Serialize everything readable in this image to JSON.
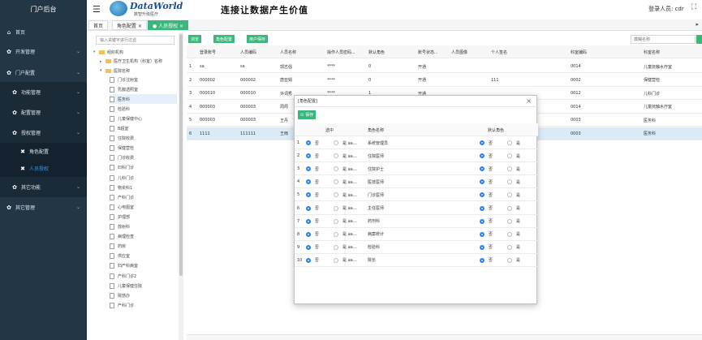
{
  "sidebar": {
    "title": "门户后台",
    "items": [
      {
        "label": "首页",
        "icon": "home-icon"
      },
      {
        "label": "开发管理",
        "icon": "gear-icon"
      },
      {
        "label": "门户配置",
        "icon": "gear-icon"
      },
      {
        "label": "功能管理",
        "icon": "gear-icon"
      },
      {
        "label": "配置管理",
        "icon": "gear-icon"
      },
      {
        "label": "授权管理",
        "icon": "gear-icon"
      },
      {
        "label": "角色配置",
        "icon": "tools-icon"
      },
      {
        "label": "人员授权",
        "icon": "tools-icon"
      },
      {
        "label": "其它功能",
        "icon": "gear-icon"
      },
      {
        "label": "其它管理",
        "icon": "gear-icon"
      }
    ]
  },
  "header": {
    "logo_text": "DataWorld",
    "logo_sub": "数智升级医疗",
    "slogan": "连接让数据产生价值",
    "user_label": "登录人员: cdr"
  },
  "tabs": [
    {
      "label": "首页"
    },
    {
      "label": "角色配置 ×"
    },
    {
      "label": "● 人员授权 ×"
    }
  ],
  "tree": {
    "search_placeholder": "输入关键字进行过滤",
    "nodes": [
      "组织机构",
      "医疗卫生机构（科室）名称",
      "医院名称",
      "门诊注射室",
      "乳腺透照室",
      "医务科",
      "检验科",
      "儿童保健中心",
      "B超室",
      "住院收费",
      "保健营检",
      "门诊收费",
      "妇科门诊",
      "儿科门诊",
      "物资科1",
      "产科门诊",
      "心电图室",
      "护理部",
      "放射科",
      "病理检查",
      "药房",
      "供应室",
      "妇产科病室",
      "产科门诊2",
      "儿童保健住院",
      "院感办",
      "产科门诊"
    ]
  },
  "toolbar": {
    "buttons": [
      "浏览",
      "角色配置",
      "用户保存"
    ],
    "search_placeholder": "模糊名称"
  },
  "grid": {
    "headers": [
      "登录账号",
      "人员编码",
      "人员名称",
      "操作人员密码...",
      "默认角色",
      "账号状态...",
      "人员图像",
      "个人签名",
      "科室编码",
      "科室名称"
    ],
    "rows": [
      [
        "sa",
        "sa",
        "郭志强",
        "****",
        "0",
        "开通",
        "",
        "",
        "0014",
        "儿童抚触水疗室"
      ],
      [
        "000002",
        "000002",
        "唐亚娟",
        "****",
        "0",
        "开通",
        "",
        "111",
        "0002",
        "保健营检"
      ],
      [
        "000010",
        "000010",
        "许词秀",
        "****",
        "1",
        "开通",
        "",
        "",
        "0012",
        "儿科门诊"
      ],
      [
        "000003",
        "000003",
        "周周",
        "",
        "",
        "",
        "",
        "",
        "0014",
        "儿童抚触水疗室"
      ],
      [
        "000003",
        "000003",
        "王丹",
        "",
        "",
        "",
        "",
        "",
        "0003",
        "医务科"
      ],
      [
        "1111",
        "111111",
        "王雨",
        "",
        "",
        "",
        "",
        "",
        "0003",
        "医务科"
      ]
    ]
  },
  "dialog": {
    "title": "[角色配置]",
    "save_label": "保存",
    "headers": [
      "选中",
      "角色名称",
      "默认角色"
    ],
    "no_label": "否",
    "yes_label": "是 aa...",
    "yes_short": "是",
    "rows": [
      {
        "role": "系统管理员"
      },
      {
        "role": "住院医师"
      },
      {
        "role": "住院护士"
      },
      {
        "role": "医技医师"
      },
      {
        "role": "门诊医师"
      },
      {
        "role": "主任医师"
      },
      {
        "role": "药剂科"
      },
      {
        "role": "病案统计"
      },
      {
        "role": "检验科"
      },
      {
        "role": "院长"
      }
    ]
  },
  "colors": {
    "sidebar": "#233646",
    "accent": "#3bb77e",
    "radio": "#2d7ff9"
  }
}
